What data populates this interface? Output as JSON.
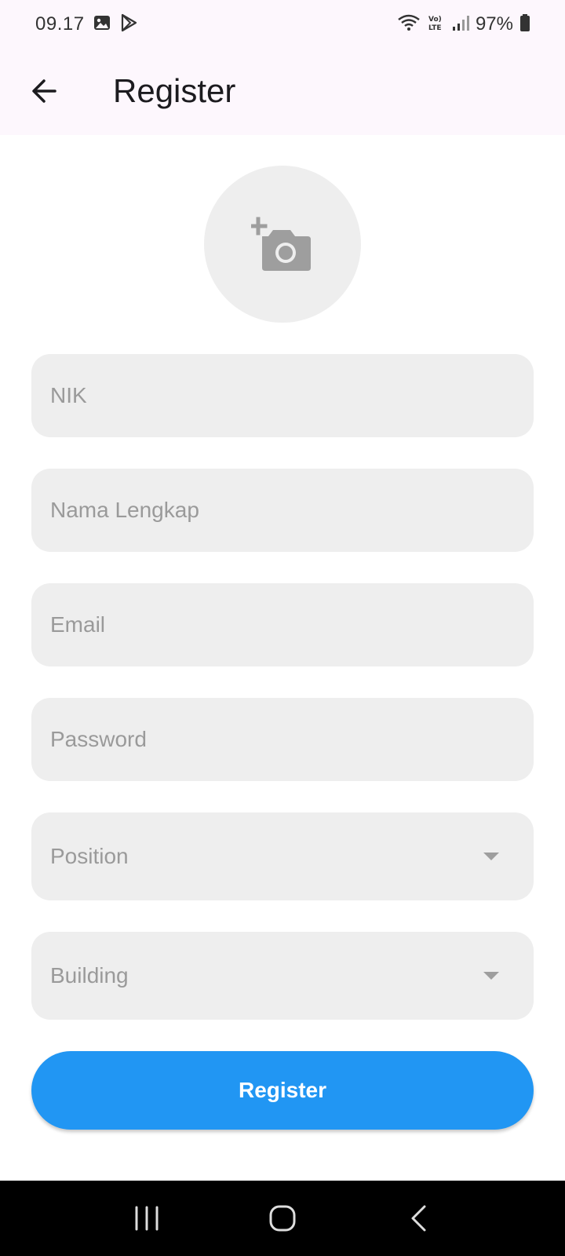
{
  "status_bar": {
    "time": "09.17",
    "battery": "97%",
    "icons": [
      "gallery-icon",
      "play-store-icon",
      "wifi-icon",
      "volte-icon",
      "signal-icon",
      "battery-icon"
    ]
  },
  "app_bar": {
    "title": "Register",
    "back_icon": "arrow-back-icon"
  },
  "avatar": {
    "icon": "add-a-photo-icon"
  },
  "form": {
    "nik_placeholder": "NIK",
    "name_placeholder": "Nama Lengkap",
    "email_placeholder": "Email",
    "password_placeholder": "Password",
    "position_label": "Position",
    "building_label": "Building",
    "submit_label": "Register"
  },
  "colors": {
    "accent": "#2196f3",
    "app_bar_bg": "#fdf7fd",
    "field_bg": "#eeeeee",
    "placeholder": "#9a9a9a"
  },
  "nav_bar": {
    "icons": [
      "recent-apps-icon",
      "home-icon",
      "back-icon"
    ]
  }
}
